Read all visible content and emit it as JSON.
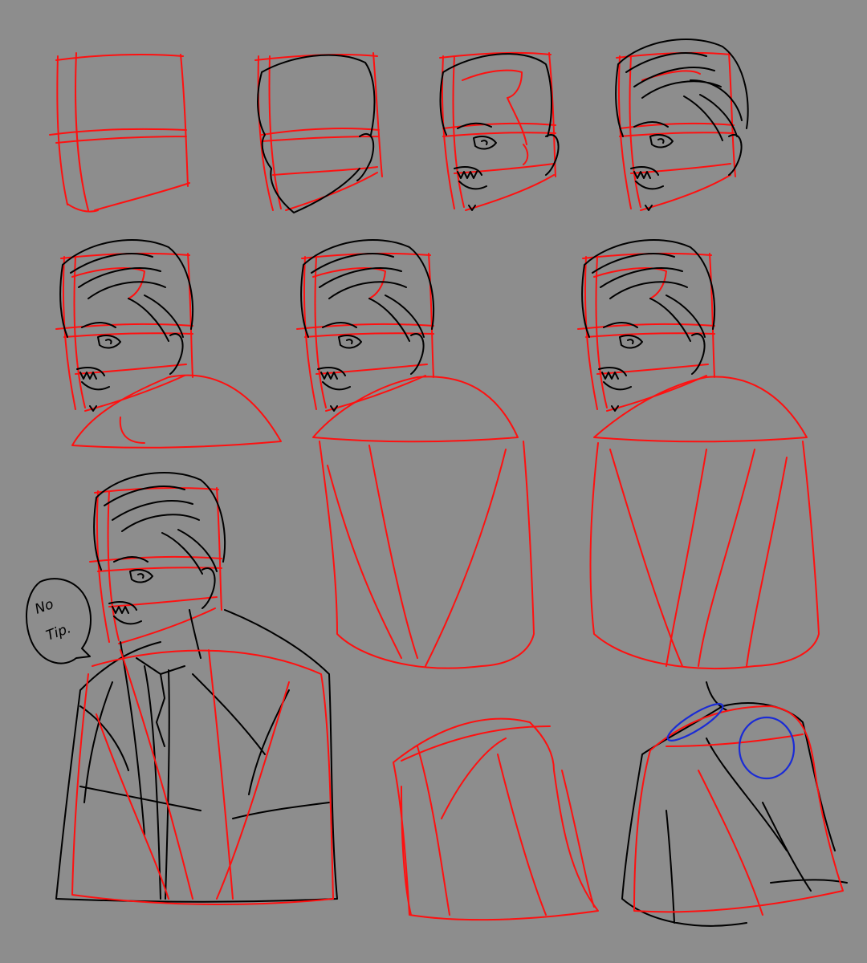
{
  "canvas": {
    "background": "#8d8d8d"
  },
  "colors": {
    "construction": "#ff1010",
    "lineart": "#000000",
    "anatomy": "#1a2bd6"
  },
  "speech_bubble": {
    "line1": "No",
    "line2": "Tip."
  }
}
